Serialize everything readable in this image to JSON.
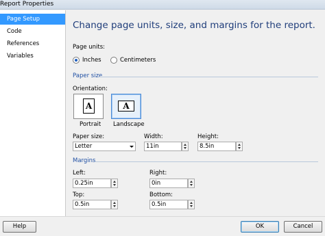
{
  "window": {
    "title": "Report Properties"
  },
  "nav": {
    "items": [
      {
        "label": "Page Setup"
      },
      {
        "label": "Code"
      },
      {
        "label": "References"
      },
      {
        "label": "Variables"
      }
    ]
  },
  "main": {
    "heading": "Change page units, size, and margins for the report.",
    "page_units": {
      "label": "Page units:",
      "options": [
        {
          "label": "Inches",
          "checked": true
        },
        {
          "label": "Centimeters",
          "checked": false
        }
      ]
    },
    "paper": {
      "section_label": "Paper size",
      "orientation_label": "Orientation:",
      "portrait_label": "Portrait",
      "landscape_label": "Landscape",
      "selected_orientation": "landscape",
      "paper_size_label": "Paper size:",
      "paper_size_value": "Letter",
      "width_label": "Width:",
      "width_value": "11in",
      "height_label": "Height:",
      "height_value": "8.5in"
    },
    "margins": {
      "section_label": "Margins",
      "left_label": "Left:",
      "left_value": "0.25in",
      "right_label": "Right:",
      "right_value": "0in",
      "top_label": "Top:",
      "top_value": "0.5in",
      "bottom_label": "Bottom:",
      "bottom_value": "0.5in"
    }
  },
  "footer": {
    "help_label": "Help",
    "ok_label": "OK",
    "cancel_label": "Cancel"
  },
  "icons": {
    "page_letter": "A"
  }
}
